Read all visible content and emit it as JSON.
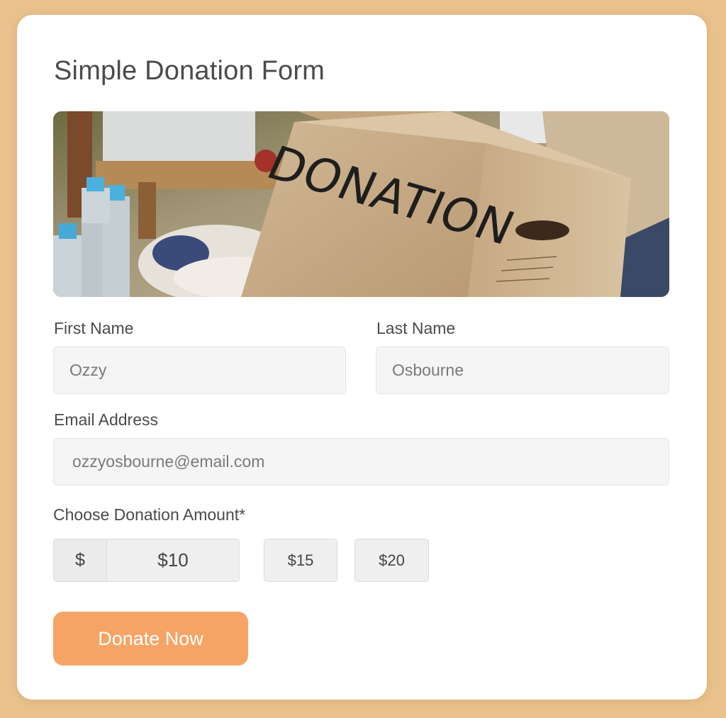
{
  "form": {
    "title": "Simple Donation Form",
    "banner_text": "DONATION",
    "first_name": {
      "label": "First Name",
      "value": "Ozzy"
    },
    "last_name": {
      "label": "Last Name",
      "value": "Osbourne"
    },
    "email": {
      "label": "Email Address",
      "value": "ozzyosbourne@email.com"
    },
    "amount": {
      "label": "Choose Donation Amount*",
      "currency_symbol": "$",
      "custom_value": "$10",
      "options": [
        "$15",
        "$20"
      ]
    },
    "submit_label": "Donate Now"
  },
  "colors": {
    "page_background": "#e8c18d",
    "card_background": "#ffffff",
    "button_accent": "#f6a466",
    "field_background": "#f5f5f5"
  }
}
